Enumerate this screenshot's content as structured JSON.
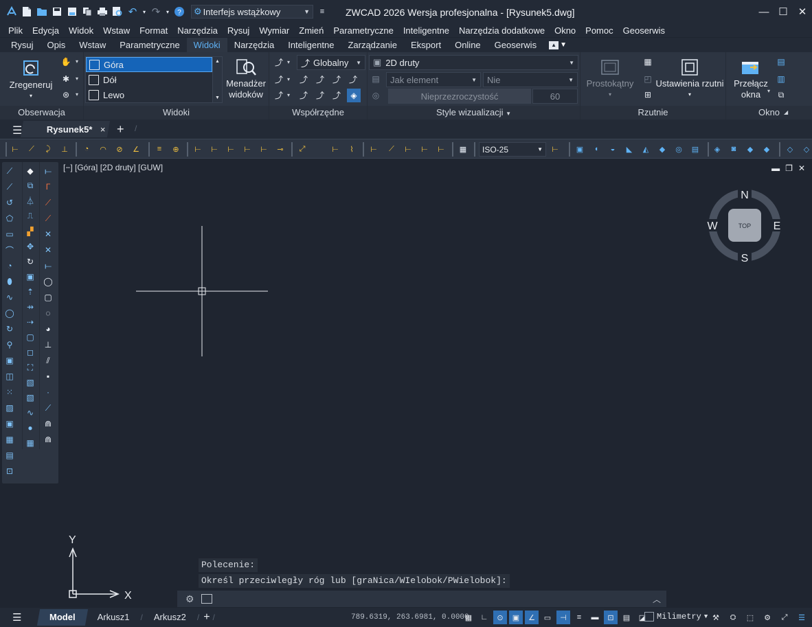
{
  "title_bar": {
    "workspace": "Interfejs wstążkowy",
    "app_title": "ZWCAD 2026 Wersja profesjonalna - [Rysunek5.dwg]",
    "help_glyph": "?"
  },
  "menu": [
    "Plik",
    "Edycja",
    "Widok",
    "Wstaw",
    "Format",
    "Narzędzia",
    "Rysuj",
    "Wymiar",
    "Zmień",
    "Parametryczne",
    "Inteligentne",
    "Narzędzia dodatkowe",
    "Okno",
    "Pomoc",
    "Geoserwis"
  ],
  "ribbon_tabs": [
    "Rysuj",
    "Opis",
    "Wstaw",
    "Parametryczne",
    "Widoki",
    "Narzędzia",
    "Inteligentne",
    "Zarządzanie",
    "Eksport",
    "Online",
    "Geoserwis"
  ],
  "ribbon_active_tab": "Widoki",
  "ribbon": {
    "observation": {
      "label": "Obserwacja",
      "regen_label": "Zregeneruj"
    },
    "views": {
      "label": "Widoki",
      "items": [
        "Góra",
        "Dół",
        "Lewo"
      ],
      "manager_label1": "Menadżer",
      "manager_label2": "widoków"
    },
    "coordinates": {
      "label": "Współrzędne",
      "ucs": "Globalny"
    },
    "visual_styles": {
      "label": "Style wizualizacji",
      "style": "2D druty",
      "element": "Jak element",
      "no": "Nie",
      "opacity_label": "Nieprzezroczystość",
      "opacity_value": "60"
    },
    "viewports": {
      "label": "Rzutnie",
      "rect_label": "Prostokątny",
      "settings_label": "Ustawienia rzutni"
    },
    "window": {
      "label": "Okno",
      "switch_label1": "Przełącz",
      "switch_label2": "okna"
    }
  },
  "file_tab": {
    "name": "Rysunek5*",
    "close": "×",
    "add": "+"
  },
  "dim_style": "ISO-25",
  "viewport": {
    "label": "[−] [Góra] [2D druty] [GUW]"
  },
  "viewcube": {
    "n": "N",
    "s": "S",
    "e": "E",
    "w": "W",
    "top": "TOP"
  },
  "ucs_icon": {
    "x": "X",
    "y": "Y"
  },
  "command": {
    "line1": "Polecenie:",
    "line2": "Określ przeciwległy róg lub [graNica/WIelobok/PWielobok]:"
  },
  "status": {
    "tabs": [
      "Model",
      "Arkusz1",
      "Arkusz2"
    ],
    "add": "+",
    "coords": "789.6319, 263.6981, 0.0000",
    "units": "Milimetry"
  }
}
